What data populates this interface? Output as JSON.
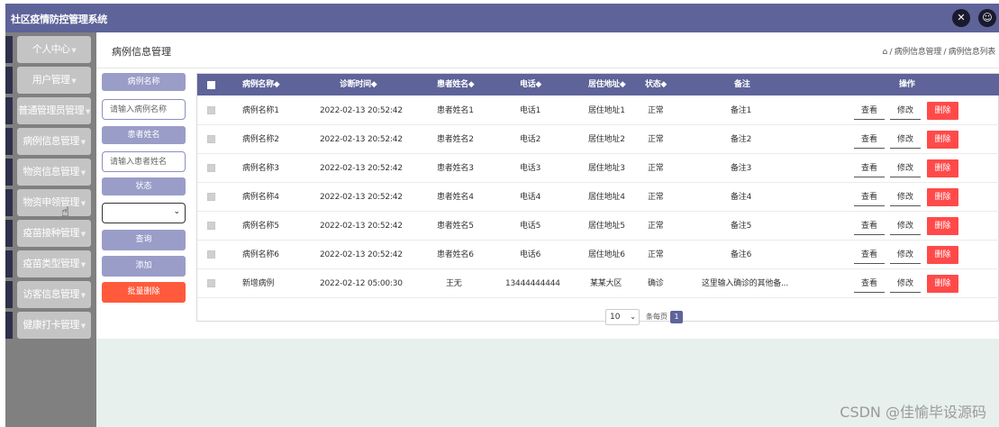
{
  "app": {
    "title": "社区疫情防控管理系统"
  },
  "topbar": {
    "expand_icon": "expand-icon",
    "user_icon": "user-icon"
  },
  "sidebar": {
    "items": [
      {
        "label": "个人中心"
      },
      {
        "label": "用户管理"
      },
      {
        "label": "普通管理员管理"
      },
      {
        "label": "病例信息管理"
      },
      {
        "label": "物资信息管理"
      },
      {
        "label": "物资申领管理"
      },
      {
        "label": "疫苗接种管理"
      },
      {
        "label": "疫苗类型管理"
      },
      {
        "label": "访客信息管理"
      },
      {
        "label": "健康打卡管理"
      }
    ]
  },
  "page": {
    "title": "病例信息管理",
    "breadcrumb": "/ 病例信息管理 / 病例信息列表"
  },
  "search": {
    "case_name_label": "病例名称",
    "case_name_placeholder": "请输入病例名称",
    "patient_name_label": "患者姓名",
    "patient_name_placeholder": "请输入患者姓名",
    "status_label": "状态",
    "status_value": "",
    "query_button": "查询",
    "add_button": "添加",
    "batch_delete_button": "批量删除"
  },
  "table": {
    "columns": [
      "病例名称◆",
      "诊断时间◆",
      "患者姓名◆",
      "电话◆",
      "居住地址◆",
      "状态◆",
      "备注",
      "操作"
    ],
    "rows": [
      {
        "case_name": "病例名称1",
        "time": "2022-02-13 20:52:42",
        "patient": "患者姓名1",
        "phone": "电话1",
        "address": "居住地址1",
        "status": "正常",
        "note": "备注1"
      },
      {
        "case_name": "病例名称2",
        "time": "2022-02-13 20:52:42",
        "patient": "患者姓名2",
        "phone": "电话2",
        "address": "居住地址2",
        "status": "正常",
        "note": "备注2"
      },
      {
        "case_name": "病例名称3",
        "time": "2022-02-13 20:52:42",
        "patient": "患者姓名3",
        "phone": "电话3",
        "address": "居住地址3",
        "status": "正常",
        "note": "备注3"
      },
      {
        "case_name": "病例名称4",
        "time": "2022-02-13 20:52:42",
        "patient": "患者姓名4",
        "phone": "电话4",
        "address": "居住地址4",
        "status": "正常",
        "note": "备注4"
      },
      {
        "case_name": "病例名称5",
        "time": "2022-02-13 20:52:42",
        "patient": "患者姓名5",
        "phone": "电话5",
        "address": "居住地址5",
        "status": "正常",
        "note": "备注5"
      },
      {
        "case_name": "病例名称6",
        "time": "2022-02-13 20:52:42",
        "patient": "患者姓名6",
        "phone": "电话6",
        "address": "居住地址6",
        "status": "正常",
        "note": "备注6"
      },
      {
        "case_name": "新增病例",
        "time": "2022-02-12 05:00:30",
        "patient": "王无",
        "phone": "13444444444",
        "address": "某某大区",
        "status": "确诊",
        "note": "这里输入确诊的其他备..."
      }
    ],
    "actions": {
      "view": "查看",
      "edit": "修改",
      "delete": "删除"
    }
  },
  "pagination": {
    "page_size": "10",
    "page_size_label": "条每页",
    "current_page": "1"
  },
  "watermark": "CSDN @佳愉毕设源码",
  "colors": {
    "primary": "#5e6399",
    "danger": "#ff4a4a",
    "batch_delete": "#ff5a3c",
    "sidebar_bg": "#808080"
  }
}
